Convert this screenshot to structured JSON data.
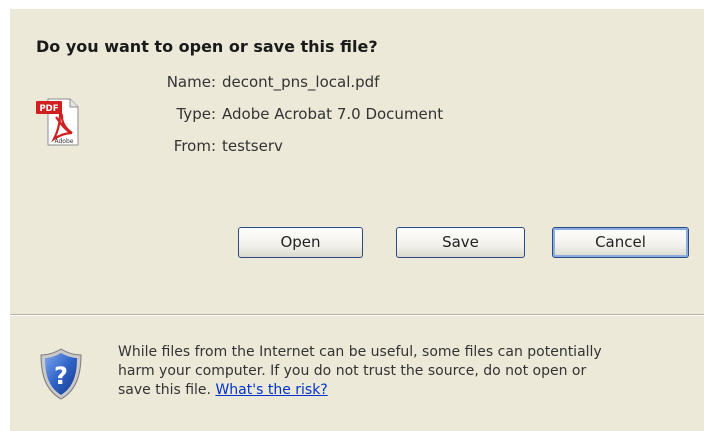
{
  "dialog": {
    "question": "Do you want to open or save this file?",
    "file_icon": "pdf-file-icon",
    "file_icon_badge": "PDF",
    "file_icon_caption": "Adobe",
    "fields": [
      {
        "label": "Name:",
        "value": "decont_pns_local.pdf"
      },
      {
        "label": "Type:",
        "value": "Adobe Acrobat 7.0 Document"
      },
      {
        "label": "From:",
        "value": "testserv"
      }
    ],
    "buttons": {
      "open": "Open",
      "save": "Save",
      "cancel": "Cancel"
    },
    "warning": {
      "icon": "shield-question-icon",
      "text_line1": "While files from the Internet can be useful, some files can potentially",
      "text_line2": "harm your computer. If you do not trust the source, do not open or",
      "text_line3": "save this file.",
      "link": "What's the risk?"
    }
  },
  "colors": {
    "dialog_background": "#ece9d8",
    "button_border": "#2c4b84",
    "link": "#0033cc"
  }
}
